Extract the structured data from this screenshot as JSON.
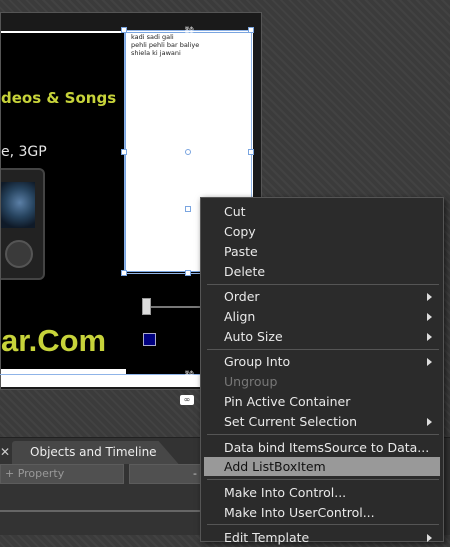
{
  "canvas": {
    "headline": "deos & Songs",
    "subline": "e, 3GP",
    "brand": "ar.Com",
    "listbox_items": [
      "kadi sadi gali",
      "pehli pehli bar baliye",
      "shiela ki jawani"
    ]
  },
  "panel": {
    "tab_label": "Objects and Timeline",
    "tab_close": "✕",
    "property_search_placeholder": "+ Property",
    "right_field_text": "-"
  },
  "context_menu": {
    "items": [
      {
        "label": "Cut",
        "submenu": false,
        "disabled": false
      },
      {
        "label": "Copy",
        "submenu": false,
        "disabled": false
      },
      {
        "label": "Paste",
        "submenu": false,
        "disabled": false
      },
      {
        "label": "Delete",
        "submenu": false,
        "disabled": false
      },
      {
        "label": "Order",
        "submenu": true,
        "disabled": false
      },
      {
        "label": "Align",
        "submenu": true,
        "disabled": false
      },
      {
        "label": "Auto Size",
        "submenu": true,
        "disabled": false
      },
      {
        "label": "Group Into",
        "submenu": true,
        "disabled": false
      },
      {
        "label": "Ungroup",
        "submenu": false,
        "disabled": true
      },
      {
        "label": "Pin Active Container",
        "submenu": false,
        "disabled": false
      },
      {
        "label": "Set Current Selection",
        "submenu": true,
        "disabled": false
      },
      {
        "label": "Data bind ItemsSource to Data...",
        "submenu": false,
        "disabled": false
      },
      {
        "label": "Add ListBoxItem",
        "submenu": false,
        "disabled": false,
        "highlighted": true
      },
      {
        "label": "Make Into Control...",
        "submenu": false,
        "disabled": false
      },
      {
        "label": "Make Into UserControl...",
        "submenu": false,
        "disabled": false
      },
      {
        "label": "Edit Template",
        "submenu": true,
        "disabled": false
      }
    ]
  },
  "colors": {
    "accent_text": "#c7d33a",
    "menu_highlight": "#999999",
    "selection": "#7aa5e0"
  }
}
